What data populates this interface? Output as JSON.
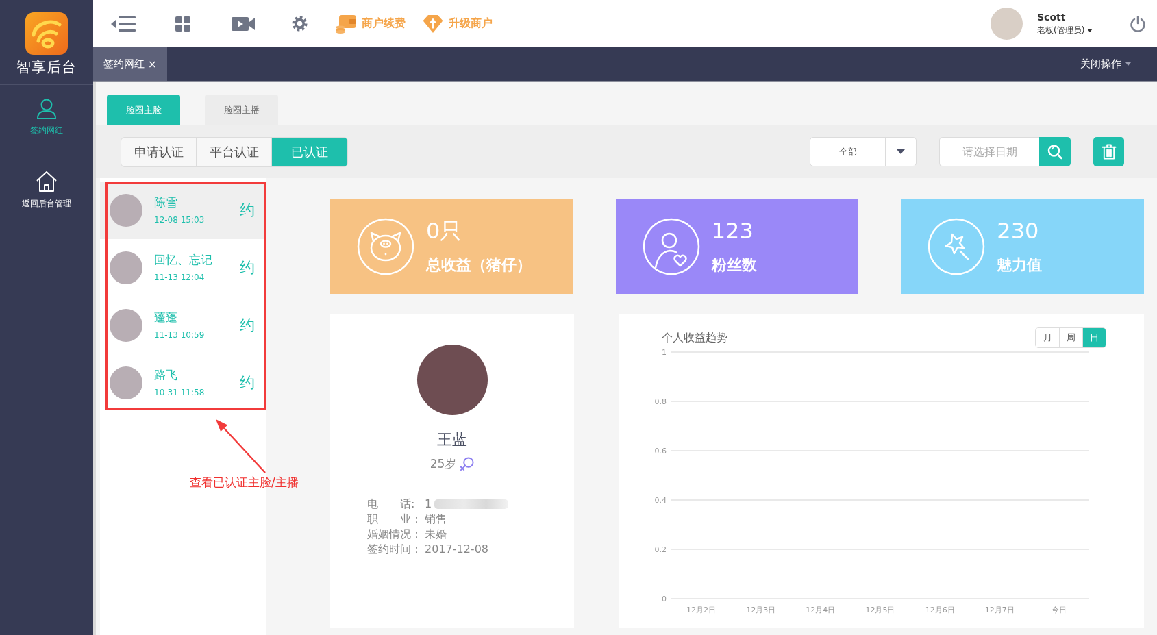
{
  "sidebar": {
    "title": "智享后台",
    "items": [
      {
        "kind": "user",
        "label": "签约网红",
        "selected": true
      },
      {
        "kind": "home",
        "label": "返回后台管理",
        "selected": false
      }
    ]
  },
  "toolbar": {
    "links": [
      {
        "kind": "wallet",
        "label": "商户续费"
      },
      {
        "kind": "upgrade",
        "label": "升级商户"
      }
    ]
  },
  "user": {
    "name": "Scott",
    "role": "老板(管理员)"
  },
  "tab_bar": {
    "tabs": [
      {
        "label": "签约网红",
        "close": "×",
        "selected": true
      }
    ],
    "menu": "关闭操作"
  },
  "category_tabs": [
    {
      "label": "脸圈主脸",
      "selected": true
    },
    {
      "label": "脸圈主播",
      "selected": false
    }
  ],
  "status_filter": [
    {
      "label": "申请认证",
      "selected": false
    },
    {
      "label": "平台认证",
      "selected": false
    },
    {
      "label": "已认证",
      "selected": true
    }
  ],
  "type_select": {
    "value": "全部"
  },
  "date_field": {
    "placeholder": "请选择日期"
  },
  "list": {
    "items": [
      {
        "name": "陈雪",
        "time": "12-08 15:03",
        "action": "约",
        "selected": true
      },
      {
        "name": "回忆、忘记",
        "time": "11-13 12:04",
        "action": "约",
        "selected": false
      },
      {
        "name": "蓬蓬",
        "time": "11-13 10:59",
        "action": "约",
        "selected": false
      },
      {
        "name": "路飞",
        "time": "10-31 11:58",
        "action": "约",
        "selected": false
      }
    ]
  },
  "annotation": {
    "text": "查看已认证主脸/主播"
  },
  "stats": [
    {
      "kind": "piggy",
      "value": "0只",
      "label": "总收益（猪仔）",
      "color": "#f7c283"
    },
    {
      "kind": "fans",
      "value": "123",
      "label": "粉丝数",
      "color": "#9a88f8"
    },
    {
      "kind": "charm",
      "value": "230",
      "label": "魅力值",
      "color": "#86d6f9"
    }
  ],
  "profile": {
    "name": "王蓝",
    "age": "25岁",
    "fields": [
      {
        "label": "电　　话:",
        "value": "1",
        "redacted": true
      },
      {
        "label": "职　　业：",
        "value": "销售",
        "redacted": false
      },
      {
        "label": "婚姻情况：",
        "value": "未婚",
        "redacted": false
      },
      {
        "label": "签约时间：",
        "value": "2017-12-08",
        "redacted": false
      }
    ]
  },
  "chart": {
    "periods": [
      {
        "label": "月",
        "selected": false
      },
      {
        "label": "周",
        "selected": false
      },
      {
        "label": "日",
        "selected": true
      }
    ],
    "chart_data": {
      "type": "line",
      "title": "个人收益趋势",
      "categories": [
        "12月2日",
        "12月3日",
        "12月4日",
        "12月5日",
        "12月6日",
        "12月7日",
        "今日"
      ],
      "ylim": [
        0,
        1
      ],
      "yticks": [
        0,
        0.2,
        0.4,
        0.6,
        0.8,
        1
      ],
      "grid": true
    }
  }
}
